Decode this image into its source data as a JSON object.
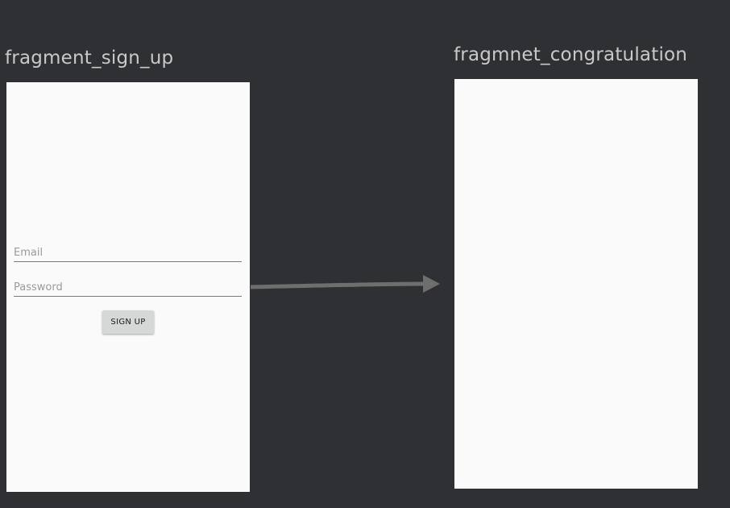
{
  "fragments": [
    {
      "label": "fragment_sign_up",
      "email_placeholder": "Email",
      "password_placeholder": "Password",
      "signup_button_label": "SIGN UP"
    },
    {
      "label": "fragmnet_congratulation"
    }
  ],
  "colors": {
    "canvas_background": "#2f3033",
    "screen_background": "#fafafa",
    "label_text": "#c9c9c9",
    "arrow": "#6e6e6e",
    "button": "#d6d7d7"
  }
}
